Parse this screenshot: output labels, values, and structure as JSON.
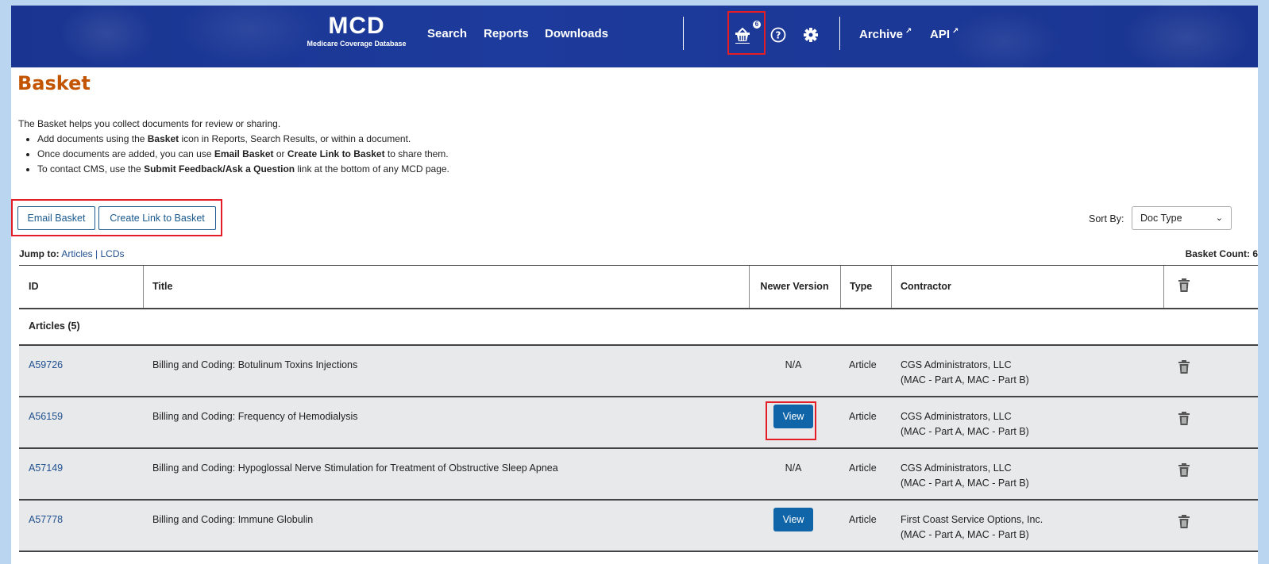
{
  "header": {
    "logo_title": "MCD",
    "logo_subtitle": "Medicare Coverage Database",
    "nav": {
      "search": "Search",
      "reports": "Reports",
      "downloads": "Downloads"
    },
    "basket_badge": "6",
    "archive": "Archive",
    "api": "API",
    "icons": {
      "basket": "basket-icon",
      "help": "help-circle-icon",
      "settings": "gear-icon",
      "external": "external-link-icon"
    }
  },
  "page": {
    "title": "Basket",
    "intro": "The Basket helps you collect documents for review or sharing.",
    "bullets": [
      {
        "pre": "Add documents using the ",
        "bold": "Basket",
        "post": " icon in Reports, Search Results, or within a document."
      },
      {
        "pre": "Once documents are added, you can use ",
        "bold": "Email Basket",
        "mid": " or ",
        "bold2": "Create Link to Basket",
        "post": " to share them."
      },
      {
        "pre": "To contact CMS, use the ",
        "bold": "Submit Feedback/Ask a Question",
        "post": " link at the bottom of any MCD page."
      }
    ]
  },
  "actions": {
    "email": "Email Basket",
    "link": "Create Link to Basket"
  },
  "sort": {
    "label": "Sort By:",
    "value": "Doc Type"
  },
  "jump": {
    "label": "Jump to:",
    "articles": "Articles",
    "sep": "|",
    "lcds": "LCDs"
  },
  "basket_count": "Basket Count: 6",
  "table": {
    "columns": {
      "id": "ID",
      "title": "Title",
      "newer": "Newer Version",
      "type": "Type",
      "contractor": "Contractor"
    },
    "group": "Articles (5)",
    "rows": [
      {
        "id": "A59726",
        "title": "Billing and Coding: Botulinum Toxins Injections",
        "newer": "N/A",
        "type": "Article",
        "contractor": "CGS Administrators, LLC",
        "contractor_sub": "(MAC - Part A, MAC - Part B)"
      },
      {
        "id": "A56159",
        "title": "Billing and Coding: Frequency of Hemodialysis",
        "newer": "View",
        "type": "Article",
        "contractor": "CGS Administrators, LLC",
        "contractor_sub": "(MAC - Part A, MAC - Part B)"
      },
      {
        "id": "A57149",
        "title": "Billing and Coding: Hypoglossal Nerve Stimulation for Treatment of Obstructive Sleep Apnea",
        "newer": "N/A",
        "type": "Article",
        "contractor": "CGS Administrators, LLC",
        "contractor_sub": "(MAC - Part A, MAC - Part B)"
      },
      {
        "id": "A57778",
        "title": "Billing and Coding: Immune Globulin",
        "newer": "View",
        "type": "Article",
        "contractor": "First Coast Service Options, Inc.",
        "contractor_sub": "(MAC - Part A, MAC - Part B)"
      }
    ]
  },
  "colors": {
    "header_bg": "#1a3591",
    "title_orange": "#c35400",
    "link_blue": "#1f4f8f",
    "view_btn": "#1065a8",
    "highlight_red": "#e41e26"
  }
}
